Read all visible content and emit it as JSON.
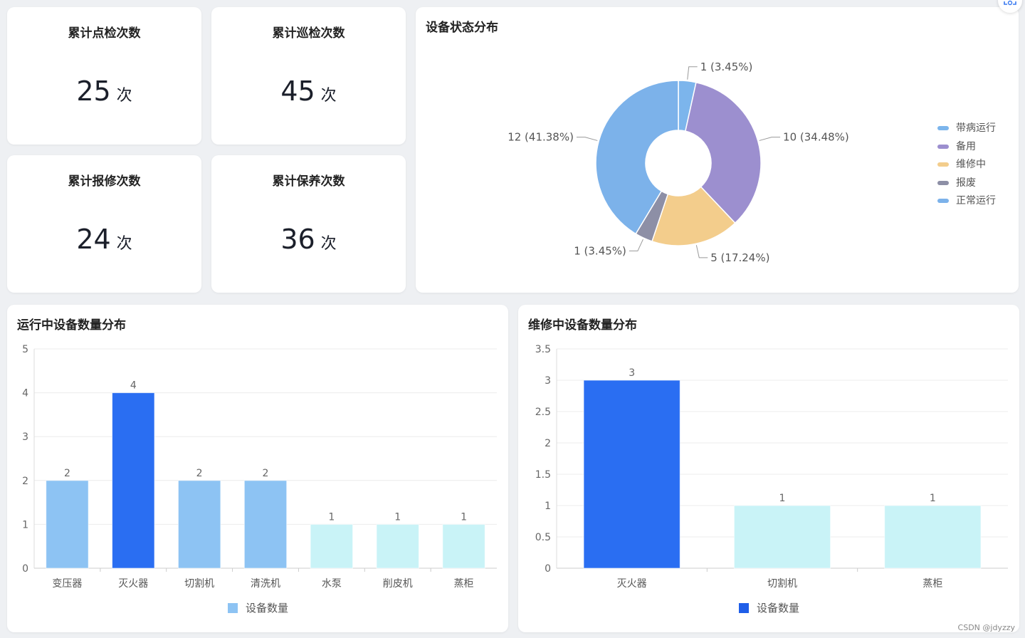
{
  "stats": [
    {
      "title": "累计点检次数",
      "value": "25",
      "unit": "次"
    },
    {
      "title": "累计巡检次数",
      "value": "45",
      "unit": "次"
    },
    {
      "title": "累计报修次数",
      "value": "24",
      "unit": "次"
    },
    {
      "title": "累计保养次数",
      "value": "36",
      "unit": "次"
    }
  ],
  "pie_panel": {
    "title": "设备状态分布"
  },
  "bar1_panel": {
    "title": "运行中设备数量分布"
  },
  "bar2_panel": {
    "title": "维修中设备数量分布"
  },
  "watermark": "CSDN @jdyzzy",
  "colors": {
    "带病运行": "#7cb5ec",
    "备用": "#9c8fcf",
    "维修中": "#f3cd8c",
    "报废": "#8d8fa6",
    "正常运行": "#7cb2ea",
    "bar_light": "#8dc3f3",
    "bar_blue": "#2a6ef2",
    "bar_cyan": "#c9f3f7"
  },
  "chart_data": [
    {
      "type": "pie",
      "title": "设备状态分布",
      "legend_position": "right",
      "slices": [
        {
          "name": "带病运行",
          "value": 1,
          "label": "1 (3.45%)"
        },
        {
          "name": "备用",
          "value": 10,
          "label": "10 (34.48%)"
        },
        {
          "name": "维修中",
          "value": 5,
          "label": "5 (17.24%)"
        },
        {
          "name": "报废",
          "value": 1,
          "label": "1 (3.45%)"
        },
        {
          "name": "正常运行",
          "value": 12,
          "label": "12 (41.38%)"
        }
      ]
    },
    {
      "type": "bar",
      "title": "运行中设备数量分布",
      "categories": [
        "变压器",
        "灭火器",
        "切割机",
        "清洗机",
        "水泵",
        "削皮机",
        "蒸柜"
      ],
      "series": [
        {
          "name": "设备数量",
          "values": [
            2,
            4,
            2,
            2,
            1,
            1,
            1
          ]
        }
      ],
      "ylim": [
        0,
        5
      ],
      "yticks": [
        "0",
        "1",
        "2",
        "3",
        "4",
        "5"
      ],
      "grid": true,
      "legend_position": "bottom"
    },
    {
      "type": "bar",
      "title": "维修中设备数量分布",
      "categories": [
        "灭火器",
        "切割机",
        "蒸柜"
      ],
      "series": [
        {
          "name": "设备数量",
          "values": [
            3,
            1,
            1
          ]
        }
      ],
      "ylim": [
        0,
        3.5
      ],
      "yticks": [
        "0",
        "0.5",
        "1",
        "1.5",
        "2",
        "2.5",
        "3",
        "3.5"
      ],
      "grid": true,
      "legend_position": "bottom"
    }
  ]
}
